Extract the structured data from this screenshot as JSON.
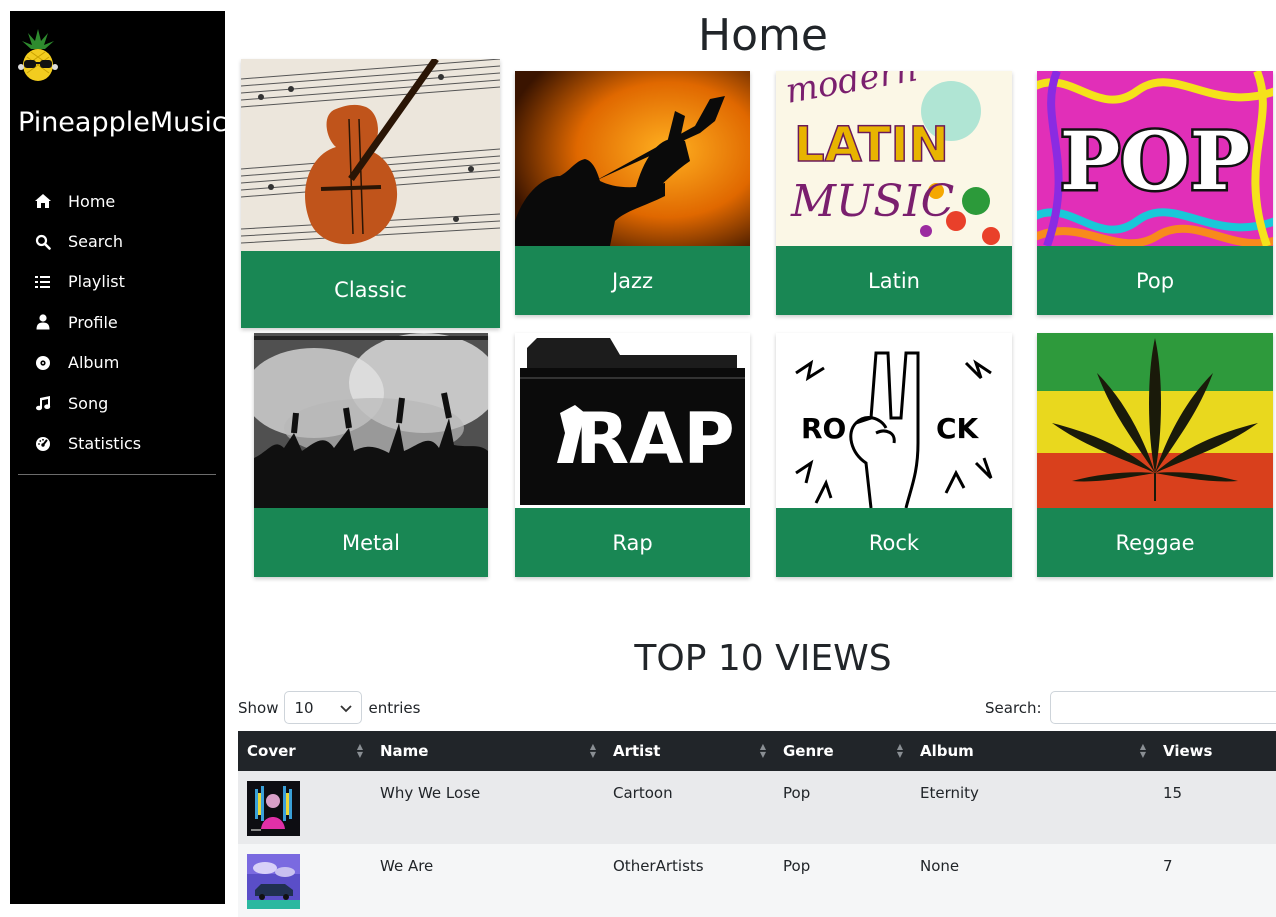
{
  "app": {
    "brand": "PineappleMusic"
  },
  "sidebar": {
    "items": [
      {
        "label": "Home",
        "icon": "home-icon"
      },
      {
        "label": "Search",
        "icon": "search-icon"
      },
      {
        "label": "Playlist",
        "icon": "list-icon"
      },
      {
        "label": "Profile",
        "icon": "user-icon"
      },
      {
        "label": "Album",
        "icon": "disc-icon"
      },
      {
        "label": "Song",
        "icon": "music-note-icon"
      },
      {
        "label": "Statistics",
        "icon": "gauge-icon"
      }
    ]
  },
  "page": {
    "title": "Home"
  },
  "genres": [
    {
      "label": "Classic"
    },
    {
      "label": "Jazz"
    },
    {
      "label": "Latin"
    },
    {
      "label": "Pop"
    },
    {
      "label": "Metal"
    },
    {
      "label": "Rap"
    },
    {
      "label": "Rock"
    },
    {
      "label": "Reggae"
    }
  ],
  "genre_art": {
    "latin_text_1": "modern",
    "latin_text_2": "LATIN",
    "latin_text_3": "MUSIC",
    "pop_text": "POP",
    "rap_text": "RAP",
    "rock_text_1": "RO",
    "rock_text_2": "CK"
  },
  "top": {
    "title": "TOP 10 VIEWS",
    "show_label": "Show",
    "entries_value": "10",
    "entries_label": "entries",
    "search_label": "Search:",
    "search_value": "",
    "columns": [
      "Cover",
      "Name",
      "Artist",
      "Genre",
      "Album",
      "Views"
    ],
    "rows": [
      {
        "name": "Why We Lose",
        "artist": "Cartoon",
        "genre": "Pop",
        "album": "Eternity",
        "views": "15"
      },
      {
        "name": "We Are",
        "artist": "OtherArtists",
        "genre": "Pop",
        "album": "None",
        "views": "7"
      }
    ]
  },
  "colors": {
    "sidebar_bg": "#000000",
    "card_label_bg": "#198754",
    "table_header_bg": "#212529"
  }
}
